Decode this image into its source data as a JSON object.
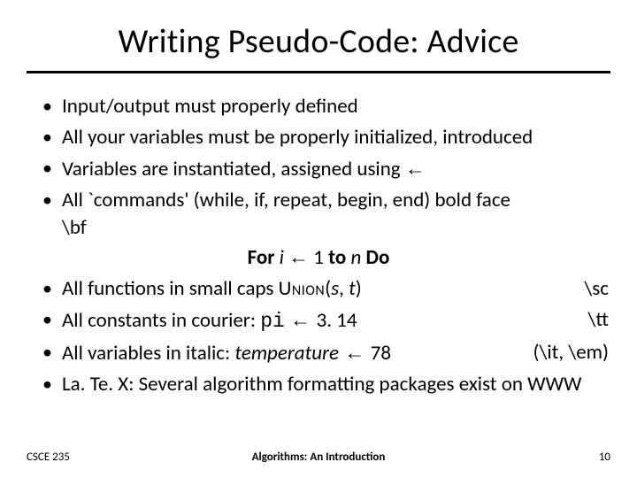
{
  "title": "Writing Pseudo-Code: Advice",
  "bullets": {
    "b1": "Input/output must properly defined",
    "b2": "All your variables must be properly initialized, introduced",
    "b3_pre": "Variables are instantiated, assigned using ",
    "b3_arrow": "←",
    "b4_line1": "All `commands' (while, if, repeat, begin, end) bold face",
    "b4_line2": "\\bf",
    "for_bold1": "For",
    "for_i": " i ",
    "for_arrow": "←",
    "for_mid": " 1 ",
    "for_bold2": "to",
    "for_n": " n ",
    "for_bold3": "Do",
    "b5_pre": "All functions in small caps  ",
    "b5_union": "Union",
    "b5_args_open": "(",
    "b5_s": "s",
    "b5_comma": ", ",
    "b5_t": "t",
    "b5_args_close": ")",
    "b5_note": "\\sc",
    "b6_pre": "All constants in courier:   ",
    "b6_pi": "pi",
    "b6_arrow": " ← ",
    "b6_val": "3. 14",
    "b6_note": "\\tt",
    "b7_pre": "All variables in italic:  ",
    "b7_var": "temperature",
    "b7_arrow": " ← ",
    "b7_val": "78",
    "b7_note": "(\\it, \\em)",
    "b8": "La. Te. X: Several algorithm formatting packages exist on WWW"
  },
  "footer": {
    "left": "CSCE 235",
    "center": "Algorithms: An Introduction",
    "right": "10"
  }
}
